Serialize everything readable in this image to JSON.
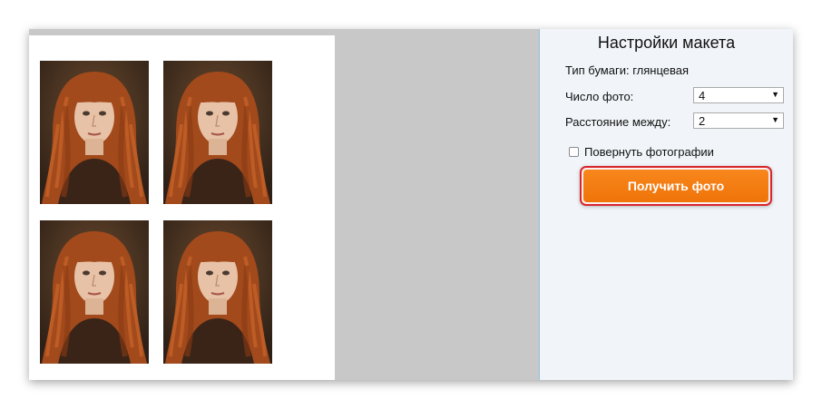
{
  "settings": {
    "title": "Настройки макета",
    "paper_type": "Тип бумаги: глянцевая",
    "photo_count_label": "Число фото:",
    "photo_count_value": "4",
    "spacing_label": "Расстояние между:",
    "spacing_value": "2",
    "rotate_label": "Повернуть фотографии",
    "rotate_checked": false,
    "get_photo_button": "Получить фото"
  },
  "preview": {
    "photo_count": 4
  },
  "colors": {
    "button": "#f37a10",
    "button_highlight": "#d7262c",
    "panel_bg": "#f1f5f9",
    "preview_bg": "#c8c8c8"
  }
}
